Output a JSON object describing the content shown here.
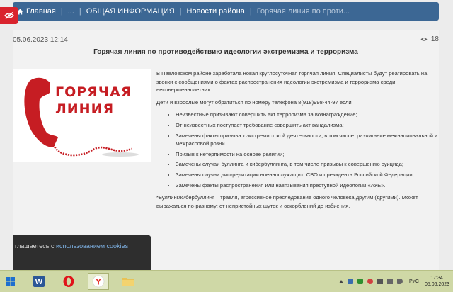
{
  "breadcrumb": {
    "items": [
      "Главная",
      "...",
      "ОБЩАЯ ИНФОРМАЦИЯ",
      "Новости района",
      "Горячая линия по проти..."
    ]
  },
  "article": {
    "date": "05.06.2023 12:14",
    "views": "18",
    "title": "Горячая линия по противодействию идеологии экстремизма и терроризма",
    "image_text_line1": "ГОРЯЧАЯ",
    "image_text_line2": "ЛИНИЯ",
    "intro": "В Павловском районе заработала новая круглосуточная горячая линия. Специалисты будут реагировать на звонки с сообщениями о фактах распространения идеологии экстремизма и терроризма среди несовершеннолетних.",
    "phone_text": "Дети и взрослые могут обратиться по номеру телефона 8(918)998-44-97 если:",
    "items": [
      "Неизвестные призывают совершить акт терроризма за вознаграждение;",
      "От неизвестных поступает требование совершить акт вандализма;",
      "Замечены факты призыва к экстремистской деятельности, в том числе: разжигание межнациональной и межрассовой розни.",
      "Призыв к нетерпимости на основе религии;",
      "Замечены случаи буллинга и кибербуллинга, в том числе призывы к совершению суицида;",
      "Замечены случаи дискредитации военнослужащих, СВО и президента Российской Федерации;",
      "Замечены факты распространения или навязывания преступной идеологии «АУЕ»."
    ],
    "footnote": "*Буллинг/кибербуллинг – травля, агрессивное преследование одного человека другим (другими). Может выражаться по-разному: от непристойных шуток и оскорблений до избиения."
  },
  "cookie": {
    "text": "глашаетесь с ",
    "link": "использованием cookies"
  },
  "taskbar": {
    "apps": [
      "word-app",
      "opera-app",
      "yandex-browser-app",
      "file-explorer-app"
    ],
    "lang": "РУС",
    "time": "17:34",
    "date": "05.06.2023"
  },
  "colors": {
    "breadcrumb_bg": "#3c6794",
    "accent_red": "#d9232d",
    "taskbar_bg": "#cfd8a6"
  }
}
